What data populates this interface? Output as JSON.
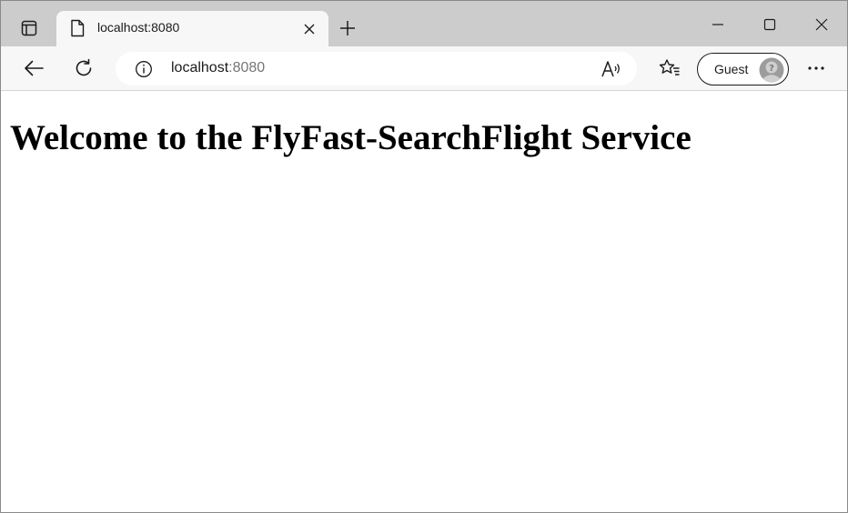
{
  "browser": {
    "tab": {
      "title": "localhost:8080"
    },
    "address": {
      "host": "localhost",
      "port": ":8080"
    },
    "profile": {
      "label": "Guest"
    }
  },
  "page": {
    "heading": "Welcome to the FlyFast-SearchFlight Service"
  },
  "colors": {
    "tabstrip": "#cccccc",
    "toolbar": "#f7f7f7",
    "text": "#1b1b1b",
    "muted": "#767676"
  },
  "icons": {
    "tab_actions": "tab-actions-icon",
    "page": "page-icon",
    "close_tab": "close-icon",
    "new_tab": "plus-icon",
    "minimize": "minimize-icon",
    "maximize": "maximize-icon",
    "close_window": "close-icon",
    "back": "back-arrow-icon",
    "reload": "reload-icon",
    "info": "info-icon",
    "read_aloud": "read-aloud-icon",
    "favorites": "favorites-icon",
    "avatar": "guest-avatar-icon",
    "more": "more-icon"
  }
}
